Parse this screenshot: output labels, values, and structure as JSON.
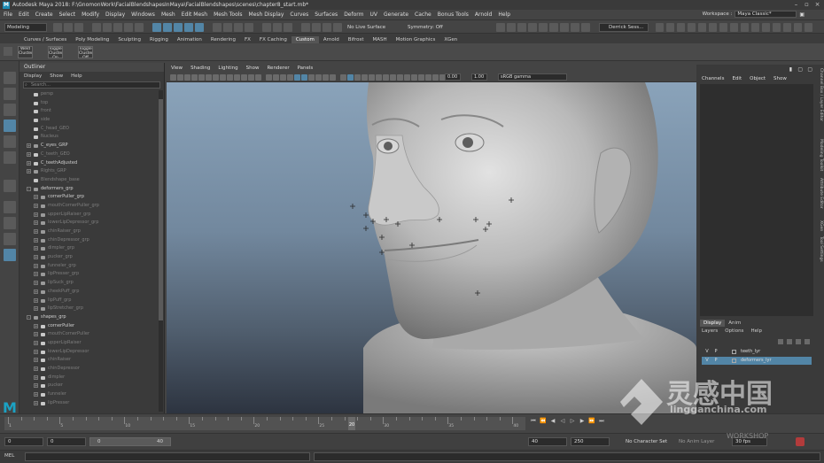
{
  "window": {
    "title": "Autodesk Maya 2018: F:\\GnomonWork\\FacialBlendshapesInMaya\\FacialBlendshapes\\scenes\\chapter8_start.mb*"
  },
  "menus": [
    "File",
    "Edit",
    "Create",
    "Select",
    "Modify",
    "Display",
    "Windows",
    "Mesh",
    "Edit Mesh",
    "Mesh Tools",
    "Mesh Display",
    "Curves",
    "Surfaces",
    "Deform",
    "UV",
    "Generate",
    "Cache",
    "Bonus Tools",
    "Arnold",
    "Help"
  ],
  "workspace": {
    "label": "Workspace :",
    "value": "Maya Classic*"
  },
  "statusline": {
    "mode": "Modeling",
    "live_surface": "No Live Surface",
    "symmetry": "Symmetry: Off",
    "user": "Derrick Sess..."
  },
  "shelf_tabs": [
    "Curves / Surfaces",
    "Poly Modeling",
    "Sculpting",
    "Rigging",
    "Animation",
    "Rendering",
    "FX",
    "FX Caching",
    "Custom",
    "Arnold",
    "Bifrost",
    "MASH",
    "Motion Graphics",
    "XGen"
  ],
  "shelf_active": "Custom",
  "shelf_buttons": [
    "Weld Cluster",
    "Toggle Cluster On",
    "Toggle Cluster Off"
  ],
  "outliner": {
    "title": "Outliner",
    "menus": [
      "Display",
      "Show",
      "Help"
    ],
    "search_placeholder": "Search...",
    "rows": [
      {
        "label": "persp",
        "indent": 1,
        "icon": "camera-icon",
        "dim": true,
        "expand": ""
      },
      {
        "label": "top",
        "indent": 1,
        "icon": "camera-icon",
        "dim": true,
        "expand": ""
      },
      {
        "label": "front",
        "indent": 1,
        "icon": "camera-icon",
        "dim": true,
        "expand": ""
      },
      {
        "label": "side",
        "indent": 1,
        "icon": "camera-icon",
        "dim": true,
        "expand": ""
      },
      {
        "label": "C_head_GEO",
        "indent": 1,
        "icon": "mesh-icon",
        "dim": true,
        "expand": ""
      },
      {
        "label": "Nucleus",
        "indent": 1,
        "icon": "node-icon",
        "dim": true,
        "expand": ""
      },
      {
        "label": "C_eyes_GRP",
        "indent": 1,
        "icon": "group-icon",
        "dim": false,
        "expand": "+"
      },
      {
        "label": "C_teeth_GEO",
        "indent": 1,
        "icon": "mesh-icon",
        "dim": true,
        "expand": "+"
      },
      {
        "label": "C_teethAdjusted",
        "indent": 1,
        "icon": "mesh-icon",
        "dim": false,
        "expand": "+"
      },
      {
        "label": "Rights_GRP",
        "indent": 1,
        "icon": "group-icon",
        "dim": true,
        "expand": "+"
      },
      {
        "label": "Blendshape_base",
        "indent": 1,
        "icon": "mesh-icon",
        "dim": true,
        "expand": ""
      },
      {
        "label": "deformers_grp",
        "indent": 1,
        "icon": "group-icon",
        "dim": false,
        "expand": "-"
      },
      {
        "label": "cornerPuller_grp",
        "indent": 2,
        "icon": "group-icon",
        "dim": false,
        "expand": "+"
      },
      {
        "label": "mouthCornerPuller_grp",
        "indent": 2,
        "icon": "group-icon",
        "dim": true,
        "expand": "+"
      },
      {
        "label": "upperLipRaiser_grp",
        "indent": 2,
        "icon": "group-icon",
        "dim": true,
        "expand": "+"
      },
      {
        "label": "lowerLipDepressor_grp",
        "indent": 2,
        "icon": "group-icon",
        "dim": true,
        "expand": "+"
      },
      {
        "label": "chinRaiser_grp",
        "indent": 2,
        "icon": "group-icon",
        "dim": true,
        "expand": "+"
      },
      {
        "label": "chinDepressor_grp",
        "indent": 2,
        "icon": "group-icon",
        "dim": true,
        "expand": "+"
      },
      {
        "label": "dimpler_grp",
        "indent": 2,
        "icon": "group-icon",
        "dim": true,
        "expand": "+"
      },
      {
        "label": "pucker_grp",
        "indent": 2,
        "icon": "group-icon",
        "dim": true,
        "expand": "+"
      },
      {
        "label": "funneler_grp",
        "indent": 2,
        "icon": "group-icon",
        "dim": true,
        "expand": "+"
      },
      {
        "label": "lipPresser_grp",
        "indent": 2,
        "icon": "group-icon",
        "dim": true,
        "expand": "+"
      },
      {
        "label": "lipSuck_grp",
        "indent": 2,
        "icon": "group-icon",
        "dim": true,
        "expand": "+"
      },
      {
        "label": "cheekPuff_grp",
        "indent": 2,
        "icon": "group-icon",
        "dim": true,
        "expand": "+"
      },
      {
        "label": "lipPuff_grp",
        "indent": 2,
        "icon": "group-icon",
        "dim": true,
        "expand": "+"
      },
      {
        "label": "lipStretcher_grp",
        "indent": 2,
        "icon": "group-icon",
        "dim": true,
        "expand": "+"
      },
      {
        "label": "shapes_grp",
        "indent": 1,
        "icon": "group-icon",
        "dim": false,
        "expand": "-"
      },
      {
        "label": "cornerPuller",
        "indent": 2,
        "icon": "mesh-icon",
        "dim": false,
        "expand": "+"
      },
      {
        "label": "mouthCornerPuller",
        "indent": 2,
        "icon": "mesh-icon",
        "dim": true,
        "expand": "+"
      },
      {
        "label": "upperLipRaiser",
        "indent": 2,
        "icon": "mesh-icon",
        "dim": true,
        "expand": "+"
      },
      {
        "label": "lowerLipDepressor",
        "indent": 2,
        "icon": "mesh-icon",
        "dim": true,
        "expand": "+"
      },
      {
        "label": "chinRaiser",
        "indent": 2,
        "icon": "mesh-icon",
        "dim": true,
        "expand": "+"
      },
      {
        "label": "chinDepressor",
        "indent": 2,
        "icon": "mesh-icon",
        "dim": true,
        "expand": "+"
      },
      {
        "label": "dimpler",
        "indent": 2,
        "icon": "mesh-icon",
        "dim": true,
        "expand": "+"
      },
      {
        "label": "pucker",
        "indent": 2,
        "icon": "mesh-icon",
        "dim": true,
        "expand": "+"
      },
      {
        "label": "funneler",
        "indent": 2,
        "icon": "mesh-icon",
        "dim": true,
        "expand": "+"
      },
      {
        "label": "lipPresser",
        "indent": 2,
        "icon": "mesh-icon",
        "dim": true,
        "expand": "+"
      }
    ]
  },
  "viewport": {
    "menus": [
      "View",
      "Shading",
      "Lighting",
      "Show",
      "Renderer",
      "Panels"
    ],
    "exposure": "0.00",
    "gamma": "1.00",
    "color_space": "sRGB gamma"
  },
  "channel_box": {
    "menus": [
      "Channels",
      "Edit",
      "Object",
      "Show"
    ]
  },
  "layers": {
    "tabs": [
      "Display",
      "Anim"
    ],
    "active_tab": "Display",
    "menus": [
      "Layers",
      "Options",
      "Help"
    ],
    "rows": [
      {
        "v": "V",
        "p": "P",
        "name": "teeth_lyr",
        "selected": false
      },
      {
        "v": "V",
        "p": "P",
        "name": "deformers_lyr",
        "selected": true
      }
    ]
  },
  "side_tabs": [
    "Channel Box / Layer Editor",
    "Modeling Toolkit",
    "Attribute Editor",
    "XGen",
    "Tool Settings"
  ],
  "timeline": {
    "ticks": [
      "1",
      "5",
      "10",
      "15",
      "20",
      "25",
      "30",
      "35",
      "40"
    ],
    "current_frame": "20"
  },
  "range": {
    "start": "0",
    "anim_start": "0",
    "range_start": "0",
    "range_end": "40",
    "end": "40",
    "anim_end": "250",
    "character_set": "No Character Set",
    "anim_layer": "No Anim Layer",
    "fps": "30 fps"
  },
  "command_line": {
    "label": "MEL"
  },
  "watermark": {
    "text_cn": "灵感中国",
    "url": "lingganchina.com",
    "sub": "WORKSHOP"
  },
  "colors": {
    "accent": "#5285a6",
    "maya_logo": "#1ba2c4",
    "bg": "#444444"
  }
}
